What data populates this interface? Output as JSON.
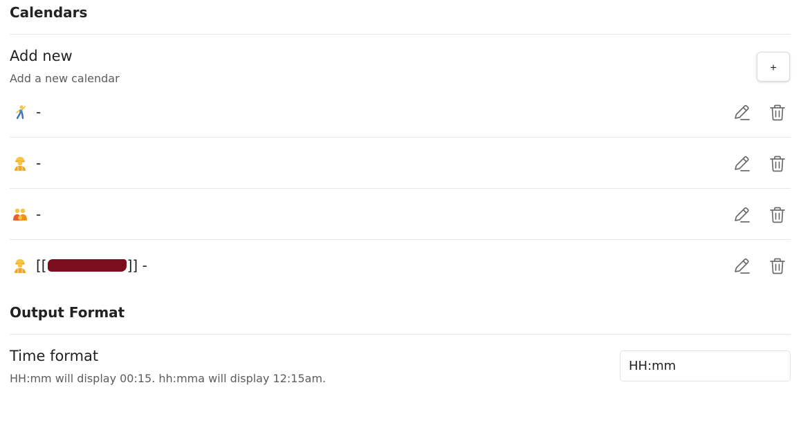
{
  "calendars": {
    "heading": "Calendars",
    "add_new": {
      "name": "Add new",
      "description": "Add a new calendar",
      "button_label": "+"
    },
    "items": [
      {
        "emoji": "person-dancing",
        "prefix": "",
        "suffix": "-",
        "redacted": false,
        "edit_icon": "pencil-icon",
        "delete_icon": "trash-icon"
      },
      {
        "emoji": "construction-worker",
        "prefix": "",
        "suffix": "-",
        "redacted": false,
        "edit_icon": "pencil-icon",
        "delete_icon": "trash-icon"
      },
      {
        "emoji": "two-people",
        "prefix": "",
        "suffix": "-",
        "redacted": false,
        "edit_icon": "pencil-icon",
        "delete_icon": "trash-icon"
      },
      {
        "emoji": "construction-worker",
        "prefix": "[[",
        "suffix": "]] -",
        "redacted": true,
        "edit_icon": "pencil-icon",
        "delete_icon": "trash-icon"
      }
    ]
  },
  "output_format": {
    "heading": "Output Format",
    "time_format": {
      "name": "Time format",
      "description": "HH:mm will display 00:15. hh:mma will display 12:15am.",
      "value": "HH:mm"
    }
  },
  "colors": {
    "icon_gray": "#6b6b6b",
    "redaction": "#7a0e1e"
  }
}
